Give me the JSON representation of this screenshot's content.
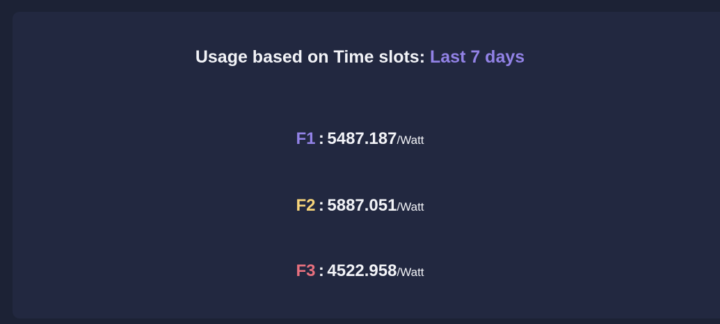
{
  "card": {
    "title_prefix": "Usage based on Time slots:",
    "title_range": "Last 7 days",
    "accent_color": "#9282e6"
  },
  "slots": [
    {
      "label": "F1",
      "separator": ":",
      "value": "5487.187",
      "unit": "/Watt",
      "color": "#9282e6"
    },
    {
      "label": "F2",
      "separator": ":",
      "value": "5887.051",
      "unit": "/Watt",
      "color": "#f7d47a"
    },
    {
      "label": "F3",
      "separator": ":",
      "value": "4522.958",
      "unit": "/Watt",
      "color": "#e8707e"
    }
  ]
}
